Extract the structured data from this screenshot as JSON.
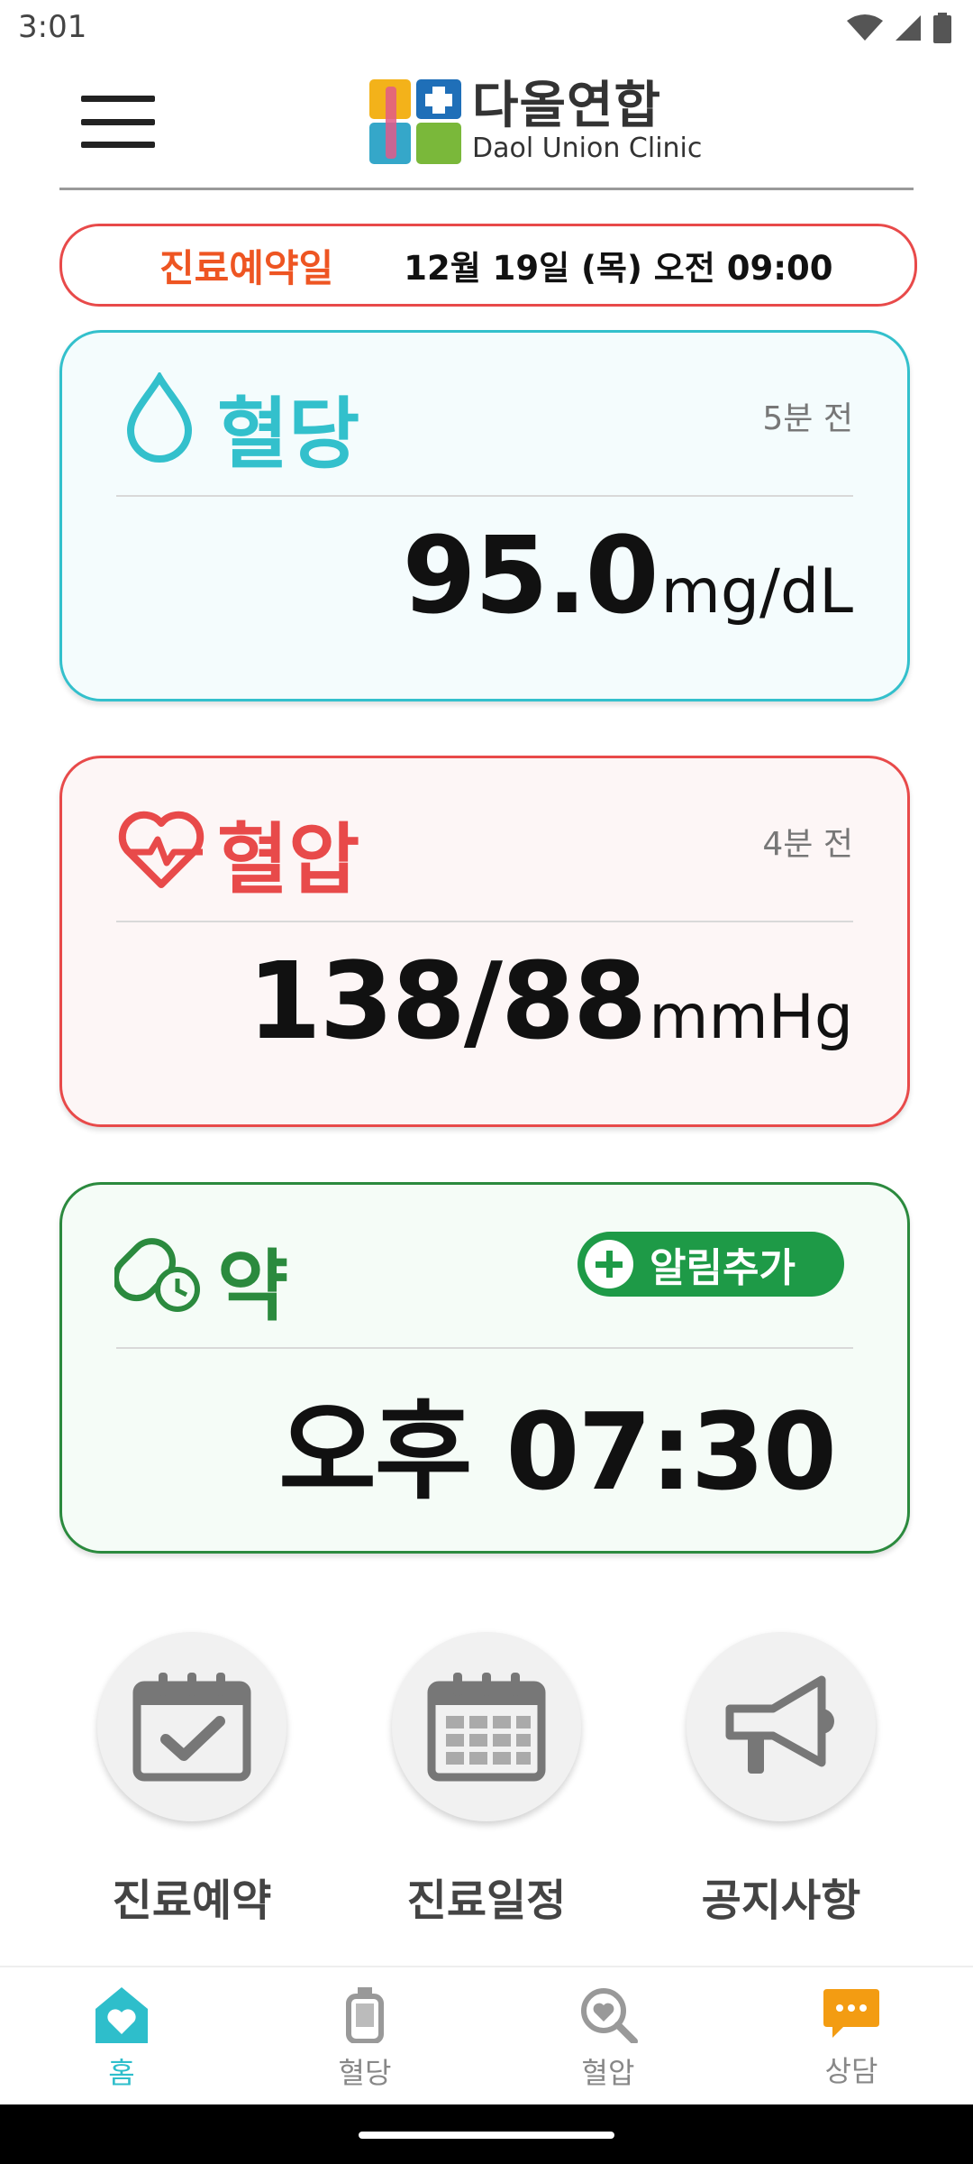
{
  "status": {
    "time": "3:01"
  },
  "header": {
    "logo_ko": "다올연합",
    "logo_en": "Daol Union Clinic"
  },
  "appointment": {
    "label": "진료예약일",
    "value": "12월 19일 (목) 오전 09:00"
  },
  "cards": {
    "blood_sugar": {
      "title": "혈당",
      "ago": "5분 전",
      "value": "95.0",
      "unit": "mg/dL",
      "color": "#33c0cc"
    },
    "blood_pressure": {
      "title": "혈압",
      "ago": "4분 전",
      "value": "138/88",
      "unit": "mmHg",
      "color": "#e84a4a"
    },
    "medicine": {
      "title": "약",
      "add_alarm": "알림추가",
      "value": "오후 07:30",
      "color": "#2b8a3e"
    }
  },
  "quick_menu": [
    {
      "label": "진료예약",
      "icon": "calendar-check-icon"
    },
    {
      "label": "진료일정",
      "icon": "calendar-grid-icon"
    },
    {
      "label": "공지사항",
      "icon": "megaphone-icon"
    }
  ],
  "bottom_nav": [
    {
      "label": "홈",
      "icon": "home-heart-icon",
      "active": true
    },
    {
      "label": "혈당",
      "icon": "glucometer-icon",
      "active": false
    },
    {
      "label": "혈압",
      "icon": "heart-search-icon",
      "active": false
    },
    {
      "label": "상담",
      "icon": "chat-bubble-icon",
      "active": false
    }
  ],
  "colors": {
    "accent": "#2ebecb",
    "banner_label": "#ee5522",
    "chat": "#f39c12"
  }
}
